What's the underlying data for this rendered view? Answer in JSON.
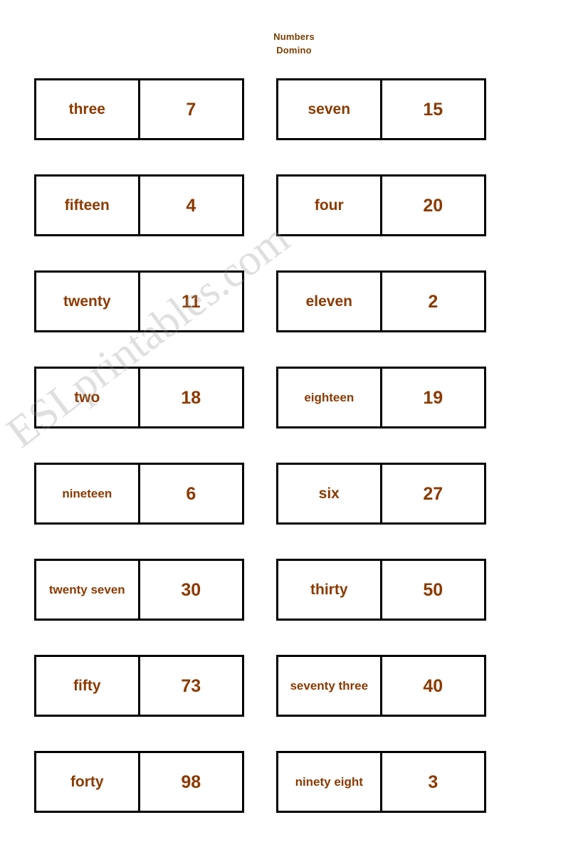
{
  "title": {
    "line1": "Numbers",
    "line2": "Domino"
  },
  "watermark": {
    "text": "ESLprintables.com"
  },
  "colors": {
    "text": "#8B3A00",
    "title": "#7B3F00",
    "border": "#000000",
    "background": "#FFFFFF"
  },
  "dominoes": [
    {
      "row": 0,
      "side": "left",
      "word": "three",
      "number": "7",
      "small": false
    },
    {
      "row": 0,
      "side": "right",
      "word": "seven",
      "number": "15",
      "small": false
    },
    {
      "row": 1,
      "side": "left",
      "word": "fifteen",
      "number": "4",
      "small": false
    },
    {
      "row": 1,
      "side": "right",
      "word": "four",
      "number": "20",
      "small": false
    },
    {
      "row": 2,
      "side": "left",
      "word": "twenty",
      "number": "11",
      "small": false
    },
    {
      "row": 2,
      "side": "right",
      "word": "eleven",
      "number": "2",
      "small": false
    },
    {
      "row": 3,
      "side": "left",
      "word": "two",
      "number": "18",
      "small": false
    },
    {
      "row": 3,
      "side": "right",
      "word": "eighteen",
      "number": "19",
      "small": true
    },
    {
      "row": 4,
      "side": "left",
      "word": "nineteen",
      "number": "6",
      "small": true
    },
    {
      "row": 4,
      "side": "right",
      "word": "six",
      "number": "27",
      "small": false
    },
    {
      "row": 5,
      "side": "left",
      "word": "twenty seven",
      "number": "30",
      "small": true
    },
    {
      "row": 5,
      "side": "right",
      "word": "thirty",
      "number": "50",
      "small": false
    },
    {
      "row": 6,
      "side": "left",
      "word": "fifty",
      "number": "73",
      "small": false
    },
    {
      "row": 6,
      "side": "right",
      "word": "seventy three",
      "number": "40",
      "small": true
    },
    {
      "row": 7,
      "side": "left",
      "word": "forty",
      "number": "98",
      "small": false
    },
    {
      "row": 7,
      "side": "right",
      "word": "ninety eight",
      "number": "3",
      "small": true
    }
  ]
}
